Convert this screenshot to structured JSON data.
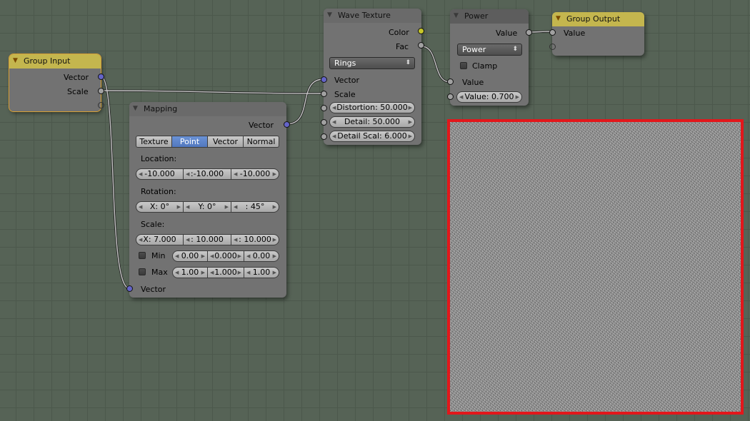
{
  "group_input": {
    "title": "Group Input",
    "outputs": [
      "Vector",
      "Scale"
    ]
  },
  "mapping": {
    "title": "Mapping",
    "output": "Vector",
    "modes": [
      "Texture",
      "Point",
      "Vector",
      "Normal"
    ],
    "active_mode": "Point",
    "location_label": "Location:",
    "location": [
      "-10.000",
      ":-10.000",
      "-10.000"
    ],
    "rotation_label": "Rotation:",
    "rotation": [
      "X: 0°",
      "Y: 0°",
      ": 45°"
    ],
    "scale_label": "Scale:",
    "scale": [
      "X: 7.000",
      ": 10.000",
      ": 10.000"
    ],
    "min_label": "Min",
    "min": [
      "0.00",
      "0.000",
      "0.00"
    ],
    "max_label": "Max",
    "max": [
      "1.00",
      "1.000",
      "1.00"
    ],
    "input": "Vector"
  },
  "wave_texture": {
    "title": "Wave Texture",
    "outputs": [
      "Color",
      "Fac"
    ],
    "type": "Rings",
    "inputs": [
      "Vector",
      "Scale"
    ],
    "distortion": "Distortion: 50.000",
    "detail": "Detail: 50.000",
    "detail_scale": "Detail Scal: 6.000"
  },
  "power": {
    "title": "Power",
    "output": "Value",
    "operation": "Power",
    "clamp_label": "Clamp",
    "input_label": "Value",
    "value_field": "Value: 0.700"
  },
  "group_output": {
    "title": "Group Output",
    "input": "Value"
  },
  "colors": {
    "grid_bg": "#566356",
    "node_body": "#727272",
    "group_header": "#c4b64e",
    "vector_socket": "#6464c8",
    "color_socket": "#c7c729",
    "float_socket": "#a1a1a1",
    "selection": "#d8a035",
    "preview_border": "#e2171b"
  }
}
